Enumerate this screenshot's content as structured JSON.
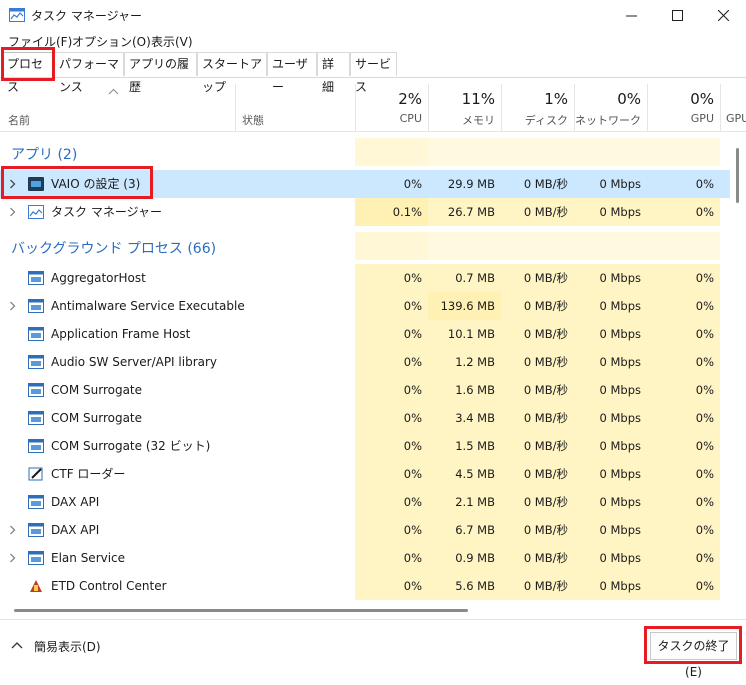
{
  "window": {
    "title": "タスク マネージャー"
  },
  "menu": [
    "ファイル(F)",
    "オプション(O)",
    "表示(V)"
  ],
  "tabs": [
    "プロセス",
    "パフォーマンス",
    "アプリの履歴",
    "スタートアップ",
    "ユーザー",
    "詳細",
    "サービス"
  ],
  "columns": {
    "name": "名前",
    "status": "状態",
    "cpu": {
      "pct": "2%",
      "label": "CPU"
    },
    "mem": {
      "pct": "11%",
      "label": "メモリ"
    },
    "disk": {
      "pct": "1%",
      "label": "ディスク"
    },
    "net": {
      "pct": "0%",
      "label": "ネットワーク"
    },
    "gpu": {
      "pct": "0%",
      "label": "GPU"
    },
    "gpu2": {
      "label": "GPU"
    }
  },
  "groups": {
    "apps": "アプリ (2)",
    "background": "バックグラウンド プロセス (66)"
  },
  "rows": [
    {
      "name": "VAIO の設定 (3)",
      "cpu": "0%",
      "mem": "29.9 MB",
      "disk": "0 MB/秒",
      "net": "0 Mbps",
      "gpu": "0%"
    },
    {
      "name": "タスク マネージャー",
      "cpu": "0.1%",
      "mem": "26.7 MB",
      "disk": "0 MB/秒",
      "net": "0 Mbps",
      "gpu": "0%"
    },
    {
      "name": "AggregatorHost",
      "cpu": "0%",
      "mem": "0.7 MB",
      "disk": "0 MB/秒",
      "net": "0 Mbps",
      "gpu": "0%"
    },
    {
      "name": "Antimalware Service Executable",
      "cpu": "0%",
      "mem": "139.6 MB",
      "disk": "0 MB/秒",
      "net": "0 Mbps",
      "gpu": "0%"
    },
    {
      "name": "Application Frame Host",
      "cpu": "0%",
      "mem": "10.1 MB",
      "disk": "0 MB/秒",
      "net": "0 Mbps",
      "gpu": "0%"
    },
    {
      "name": "Audio SW Server/API library",
      "cpu": "0%",
      "mem": "1.2 MB",
      "disk": "0 MB/秒",
      "net": "0 Mbps",
      "gpu": "0%"
    },
    {
      "name": "COM Surrogate",
      "cpu": "0%",
      "mem": "1.6 MB",
      "disk": "0 MB/秒",
      "net": "0 Mbps",
      "gpu": "0%"
    },
    {
      "name": "COM Surrogate",
      "cpu": "0%",
      "mem": "3.4 MB",
      "disk": "0 MB/秒",
      "net": "0 Mbps",
      "gpu": "0%"
    },
    {
      "name": "COM Surrogate (32 ビット)",
      "cpu": "0%",
      "mem": "1.5 MB",
      "disk": "0 MB/秒",
      "net": "0 Mbps",
      "gpu": "0%"
    },
    {
      "name": "CTF ローダー",
      "cpu": "0%",
      "mem": "4.5 MB",
      "disk": "0 MB/秒",
      "net": "0 Mbps",
      "gpu": "0%"
    },
    {
      "name": "DAX API",
      "cpu": "0%",
      "mem": "2.1 MB",
      "disk": "0 MB/秒",
      "net": "0 Mbps",
      "gpu": "0%"
    },
    {
      "name": "DAX API",
      "cpu": "0%",
      "mem": "6.7 MB",
      "disk": "0 MB/秒",
      "net": "0 Mbps",
      "gpu": "0%"
    },
    {
      "name": "Elan Service",
      "cpu": "0%",
      "mem": "0.9 MB",
      "disk": "0 MB/秒",
      "net": "0 Mbps",
      "gpu": "0%"
    },
    {
      "name": "ETD Control Center",
      "cpu": "0%",
      "mem": "5.6 MB",
      "disk": "0 MB/秒",
      "net": "0 Mbps",
      "gpu": "0%"
    }
  ],
  "footer": {
    "simple_view": "簡易表示(D)",
    "end_task": "タスクの終了(E)"
  },
  "colors": {
    "highlight": "#e51c23",
    "selected_row": "#cce8ff",
    "heat_light": "#fff4c4",
    "heat_mid": "#fff0b3",
    "group_text": "#2b6dbf"
  }
}
